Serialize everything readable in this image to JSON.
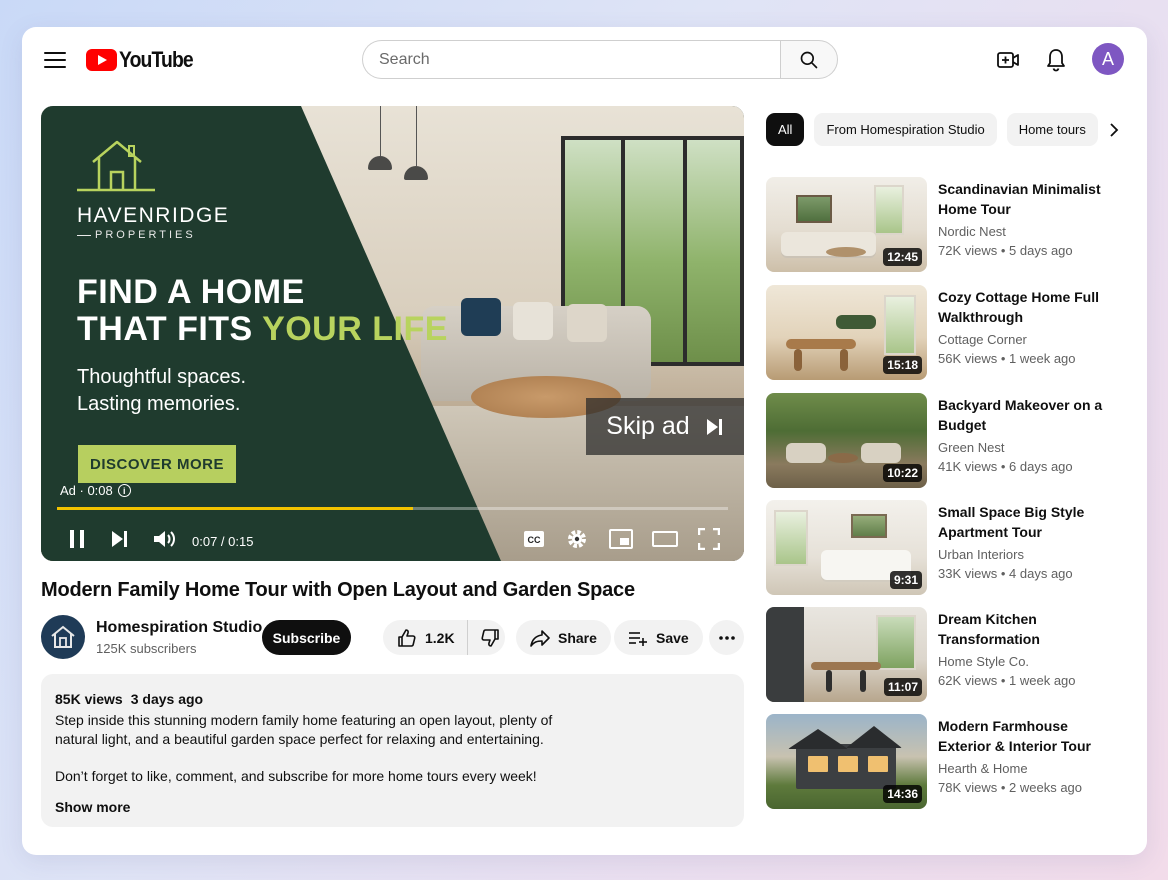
{
  "header": {
    "logo_text": "YouTube",
    "search_placeholder": "Search",
    "avatar_letter": "A"
  },
  "player": {
    "ad": {
      "brand_name": "HAVENRIDGE",
      "brand_sub": "PROPERTIES",
      "headline_line1": "FIND A HOME",
      "headline_line2_a": "THAT FITS ",
      "headline_line2_b": "YOUR LIFE",
      "tagline_line1": "Thoughtful spaces.",
      "tagline_line2": "Lasting memories.",
      "cta": "DISCOVER MORE",
      "ad_label": "Ad · 0:08",
      "skip_label": "Skip ad",
      "brand_color": "#1f3b2e",
      "accent_color": "#b8d35e"
    },
    "time": "0:07 / 0:15",
    "progress_fraction": 0.53,
    "progress_color": "#f2c300"
  },
  "video": {
    "title": "Modern Family Home Tour with Open Layout and Garden Space",
    "channel": "Homespiration Studio",
    "subscribers": "125K subscribers",
    "subscribe_label": "Subscribe",
    "likes": "1.2K",
    "share_label": "Share",
    "save_label": "Save"
  },
  "description": {
    "views": "85K views",
    "age": "3 days ago",
    "paragraph1": "Step inside this stunning modern family home featuring an open layout, plenty of natural light, and a beautiful garden space perfect for relaxing and entertaining.",
    "paragraph2": "Don’t forget to like, comment, and subscribe for more home tours every week!",
    "show_more": "Show more"
  },
  "chips": [
    {
      "label": "All"
    },
    {
      "label": "From Homespiration Studio"
    },
    {
      "label": "Home tours"
    }
  ],
  "recommendations": [
    {
      "title": "Scandinavian Minimalist Home Tour",
      "channel": "Nordic Nest",
      "meta": "72K views • 5 days ago",
      "duration": "12:45"
    },
    {
      "title": "Cozy Cottage Home Full Walkthrough",
      "channel": "Cottage Corner",
      "meta": "56K views • 1 week ago",
      "duration": "15:18"
    },
    {
      "title": "Backyard Makeover on a Budget",
      "channel": "Green Nest",
      "meta": "41K views • 6 days ago",
      "duration": "10:22"
    },
    {
      "title": "Small Space Big Style Apartment Tour",
      "channel": "Urban Interiors",
      "meta": "33K views • 4 days ago",
      "duration": "9:31"
    },
    {
      "title": "Dream Kitchen Transformation",
      "channel": "Home Style Co.",
      "meta": "62K views • 1 week ago",
      "duration": "11:07"
    },
    {
      "title": "Modern Farmhouse Exterior & Interior Tour",
      "channel": "Hearth & Home",
      "meta": "78K views • 2 weeks ago",
      "duration": "14:36"
    }
  ]
}
